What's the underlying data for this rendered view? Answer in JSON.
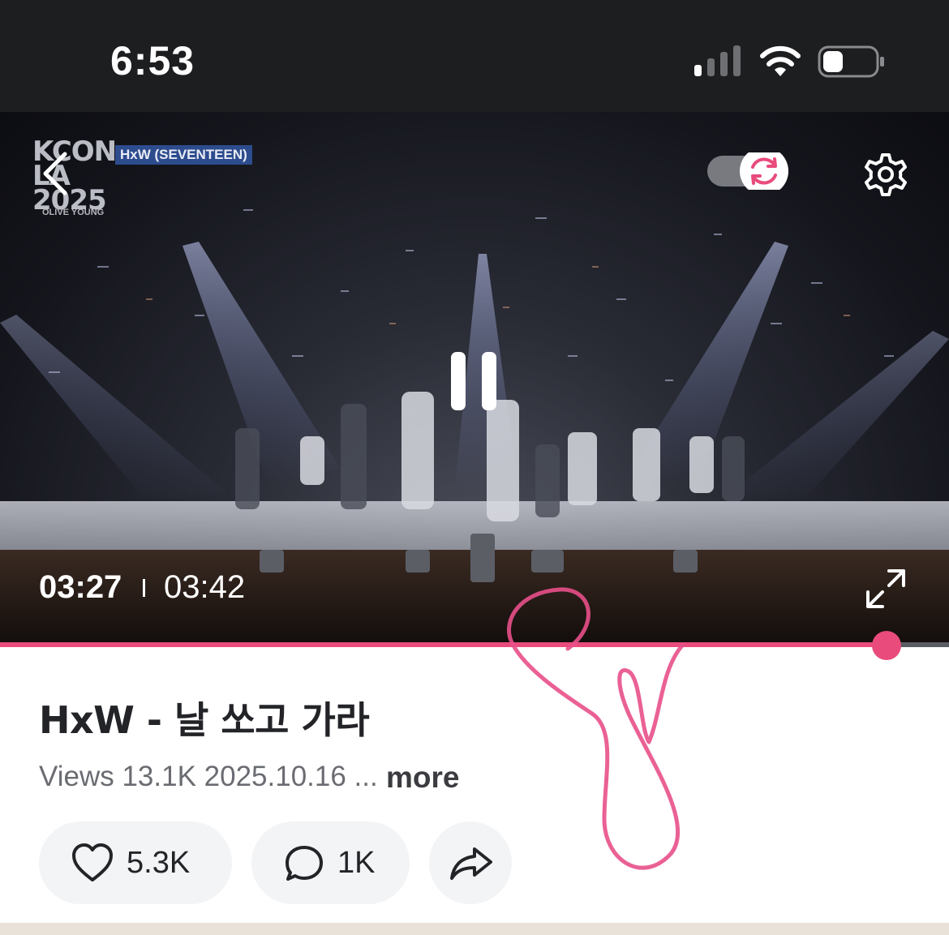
{
  "status_bar": {
    "time": "6:53"
  },
  "video": {
    "logo_text": "KCON LA 2025",
    "logo_sub": "OLIVE YOUNG",
    "artist_tag": "HxW (SEVENTEEN)",
    "current_time": "03:27",
    "total_time": "03:42",
    "progress": 0.934
  },
  "info": {
    "title": "HxW - 날 쏘고 가라",
    "meta": "Views 13.1K 2025.10.16 ...",
    "more_label": "more"
  },
  "actions": {
    "like_count": "5.3K",
    "comment_count": "1K"
  },
  "colors": {
    "accent": "#e94b7c",
    "status_bg": "#1d1e20",
    "pill_bg": "#f3f4f6"
  },
  "icons": [
    "back-arrow-icon",
    "sync-icon",
    "gear-icon",
    "pause-icon",
    "fullscreen-icon",
    "heart-icon",
    "comment-icon",
    "share-icon",
    "signal-icon",
    "wifi-icon",
    "battery-icon"
  ]
}
